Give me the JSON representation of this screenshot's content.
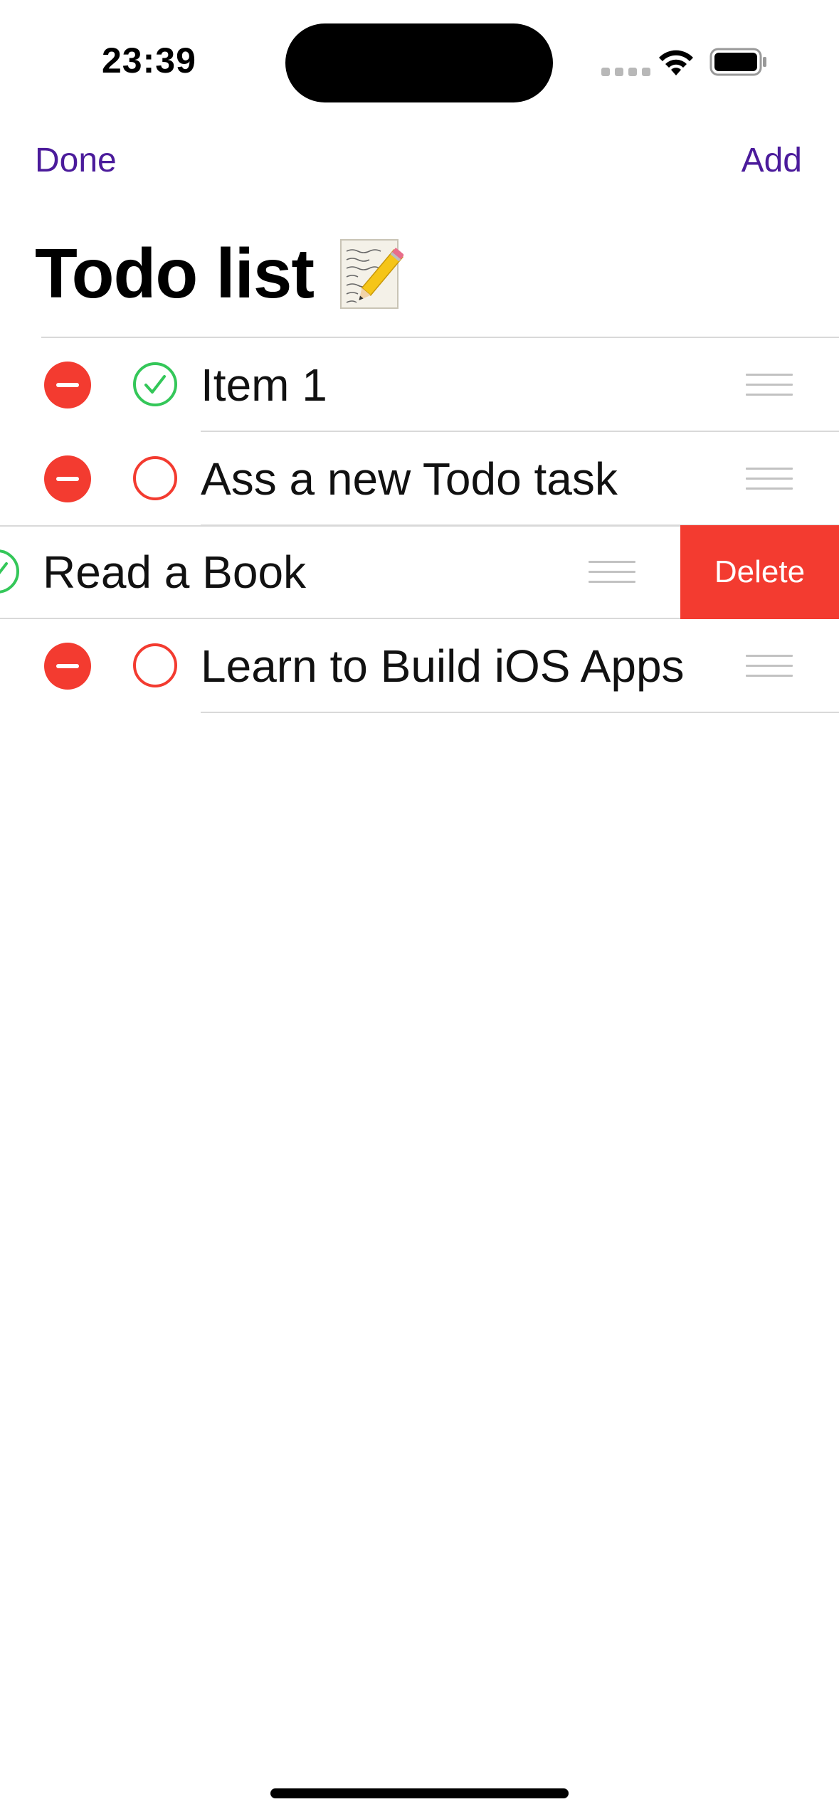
{
  "status_bar": {
    "time": "23:39",
    "icons": [
      "signal-dots-icon",
      "wifi-icon",
      "battery-icon"
    ]
  },
  "nav": {
    "done_label": "Done",
    "add_label": "Add",
    "accent_color": "#4b1b9b"
  },
  "title": {
    "text": "Todo list",
    "icon": "memo-pencil-icon"
  },
  "todos": [
    {
      "label": "Item 1",
      "completed": true,
      "swiped": false
    },
    {
      "label": "Ass a new Todo task",
      "completed": false,
      "swiped": false
    },
    {
      "label": "Read a Book",
      "completed": true,
      "swiped": true
    },
    {
      "label": "Learn to Build iOS Apps",
      "completed": false,
      "swiped": false
    }
  ],
  "swipe_action": {
    "label": "Delete",
    "color": "#f33b30"
  },
  "colors": {
    "delete_red": "#f33b30",
    "complete_green": "#34c759",
    "incomplete_red": "#f33b30"
  }
}
